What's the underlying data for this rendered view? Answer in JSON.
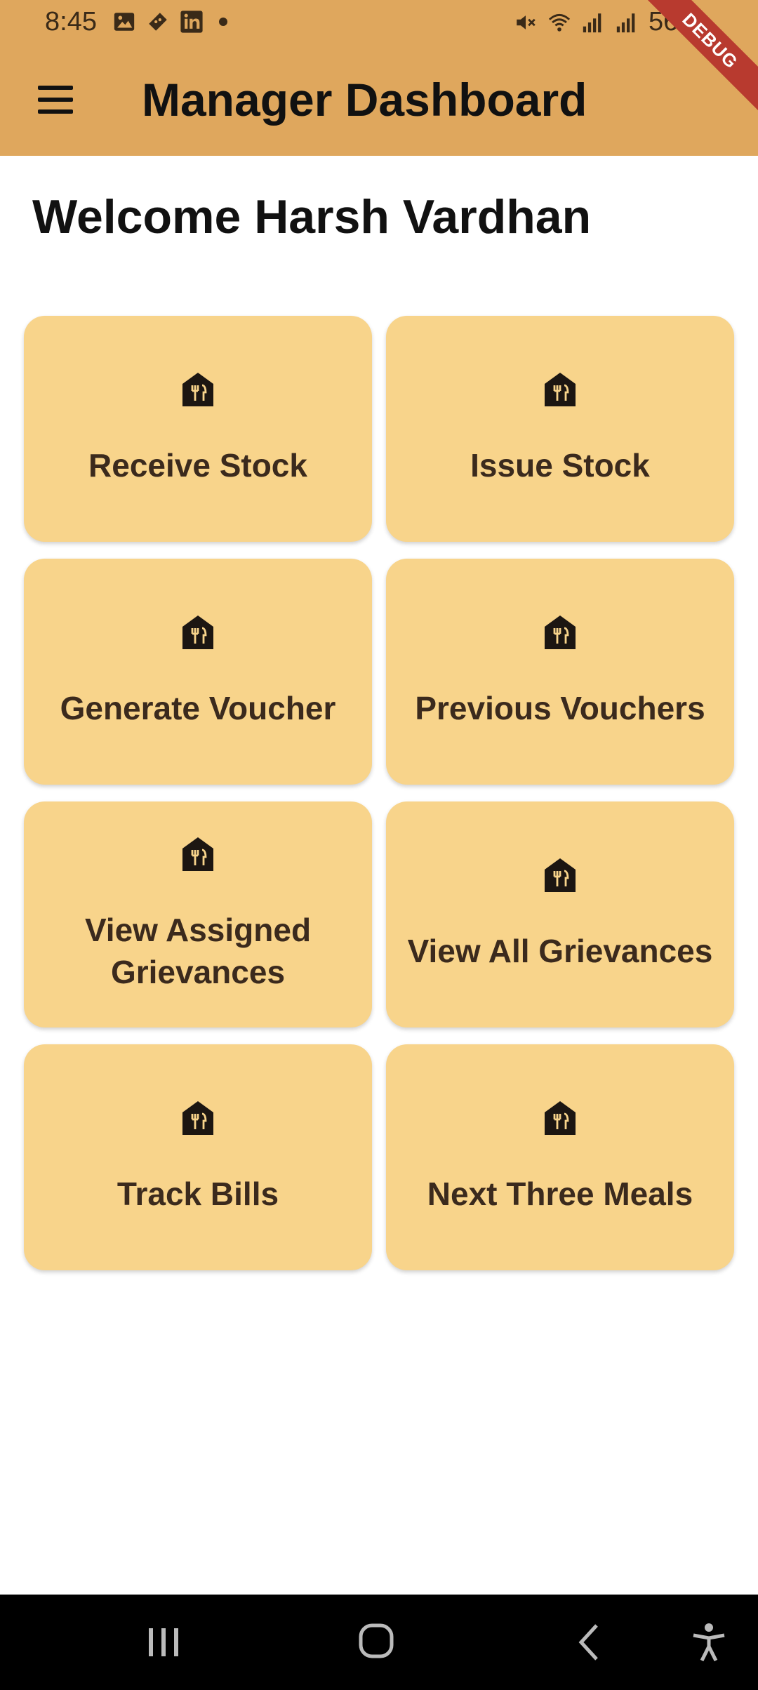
{
  "status_bar": {
    "time": "8:45",
    "battery": "56%",
    "left_icons": [
      "image-icon",
      "ticket-icon",
      "linkedin-icon",
      "notification-dot"
    ],
    "right_icons": [
      "mute-icon",
      "wifi-icon",
      "volte1-signal-icon",
      "volte2-signal-icon",
      "battery-icon"
    ]
  },
  "debug_banner": "DEBUG",
  "app_bar": {
    "title": "Manager Dashboard",
    "menu_icon": "hamburger-menu-icon",
    "background": "#dfa75d"
  },
  "welcome_text": "Welcome Harsh Vardhan",
  "tiles": [
    {
      "label": "Receive Stock",
      "icon": "restaurant-house-icon"
    },
    {
      "label": "Issue Stock",
      "icon": "restaurant-house-icon"
    },
    {
      "label": "Generate Voucher",
      "icon": "restaurant-house-icon"
    },
    {
      "label": "Previous Vouchers",
      "icon": "restaurant-house-icon"
    },
    {
      "label": "View Assigned Grievances",
      "icon": "restaurant-house-icon"
    },
    {
      "label": "View All Grievances",
      "icon": "restaurant-house-icon"
    },
    {
      "label": "Track Bills",
      "icon": "restaurant-house-icon"
    },
    {
      "label": "Next Three Meals",
      "icon": "restaurant-house-icon"
    }
  ],
  "colors": {
    "tile_background": "#f8d48b",
    "tile_text": "#3b2a1d",
    "debug_ribbon": "#b83a2f"
  },
  "nav_bar": {
    "buttons": [
      "recents-icon",
      "home-icon",
      "back-icon",
      "accessibility-icon"
    ]
  }
}
